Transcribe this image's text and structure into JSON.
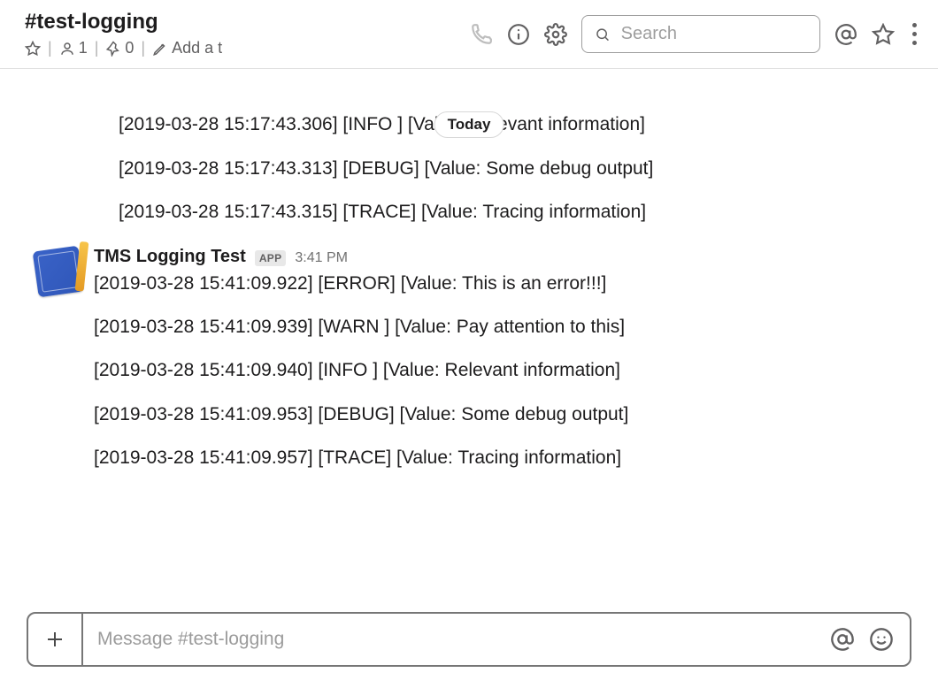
{
  "header": {
    "channel_name": "#test-logging",
    "members_count": "1",
    "pins_count": "0",
    "topic_prompt": "Add a t",
    "search_placeholder": "Search"
  },
  "divider_label": "Today",
  "prior_lines": [
    "[2019-03-28 15:17:43.306] [INFO ] [Value: Relevant information]",
    "[2019-03-28 15:17:43.313] [DEBUG] [Value: Some debug output]",
    "[2019-03-28 15:17:43.315] [TRACE] [Value: Tracing information]"
  ],
  "message": {
    "sender": "TMS Logging Test",
    "badge": "APP",
    "time": "3:41 PM",
    "lines": [
      "[2019-03-28 15:41:09.922] [ERROR] [Value: This is an error!!!]",
      "[2019-03-28 15:41:09.939] [WARN ] [Value: Pay attention to this]",
      "[2019-03-28 15:41:09.940] [INFO ] [Value: Relevant information]",
      "[2019-03-28 15:41:09.953] [DEBUG] [Value: Some debug output]",
      "[2019-03-28 15:41:09.957] [TRACE] [Value: Tracing information]"
    ]
  },
  "composer": {
    "placeholder": "Message #test-logging"
  }
}
